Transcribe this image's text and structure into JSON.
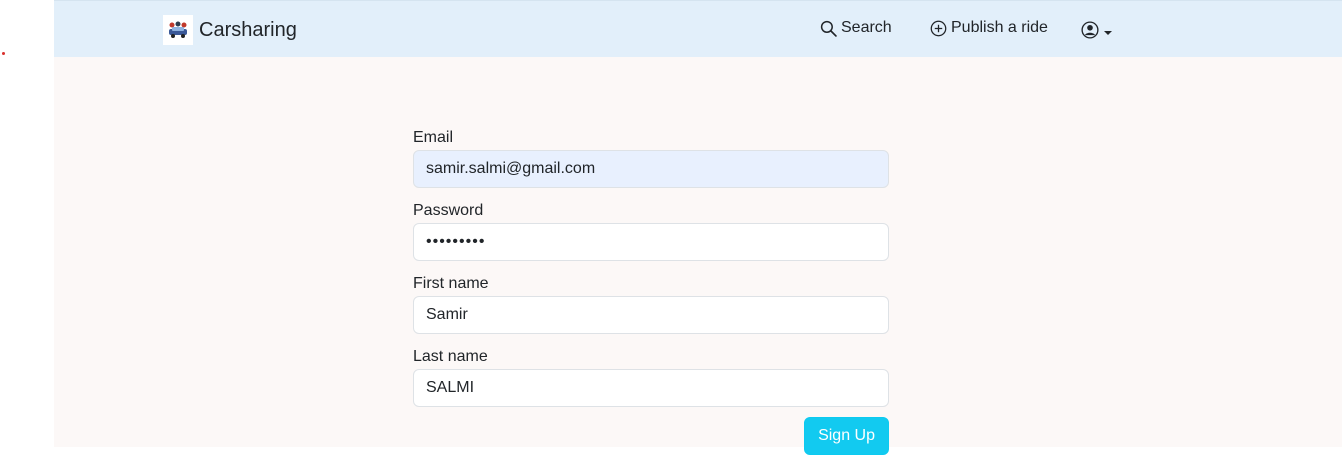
{
  "navbar": {
    "brand": "Carsharing",
    "search_label": "Search",
    "publish_label": "Publish a ride"
  },
  "form": {
    "email": {
      "label": "Email",
      "value": "samir.salmi@gmail.com"
    },
    "password": {
      "label": "Password",
      "value": "samirpass"
    },
    "first_name": {
      "label": "First name",
      "value": "Samir"
    },
    "last_name": {
      "label": "Last name",
      "value": "SALMI"
    },
    "submit_label": "Sign Up"
  },
  "colors": {
    "navbar_bg": "#e2effa",
    "page_bg": "#fcf8f7",
    "button_bg": "#12caf0",
    "autofill_bg": "#e8f0fe"
  },
  "icons": [
    "car-logo-icon",
    "search-icon",
    "plus-circle-icon",
    "user-circle-icon",
    "caret-down-icon"
  ]
}
